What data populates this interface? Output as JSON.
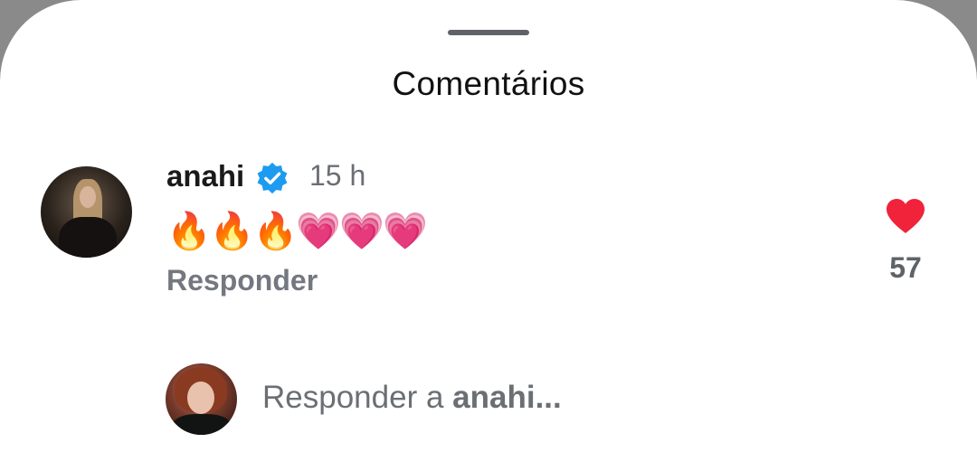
{
  "sheet": {
    "title": "Comentários"
  },
  "comment": {
    "username": "anahi",
    "verified": true,
    "timestamp": "15 h",
    "text": "🔥🔥🔥💗💗💗",
    "reply_label": "Responder",
    "like_count": "57",
    "liked": true
  },
  "reply_box": {
    "prefix": "Responder a ",
    "target": "anahi",
    "ellipsis": "..."
  },
  "colors": {
    "verified_badge": "#1d9bf0",
    "like_heart": "#f0233a",
    "muted_text": "#737880"
  },
  "icons": {
    "verified": "verified-badge-icon",
    "like": "heart-icon"
  }
}
